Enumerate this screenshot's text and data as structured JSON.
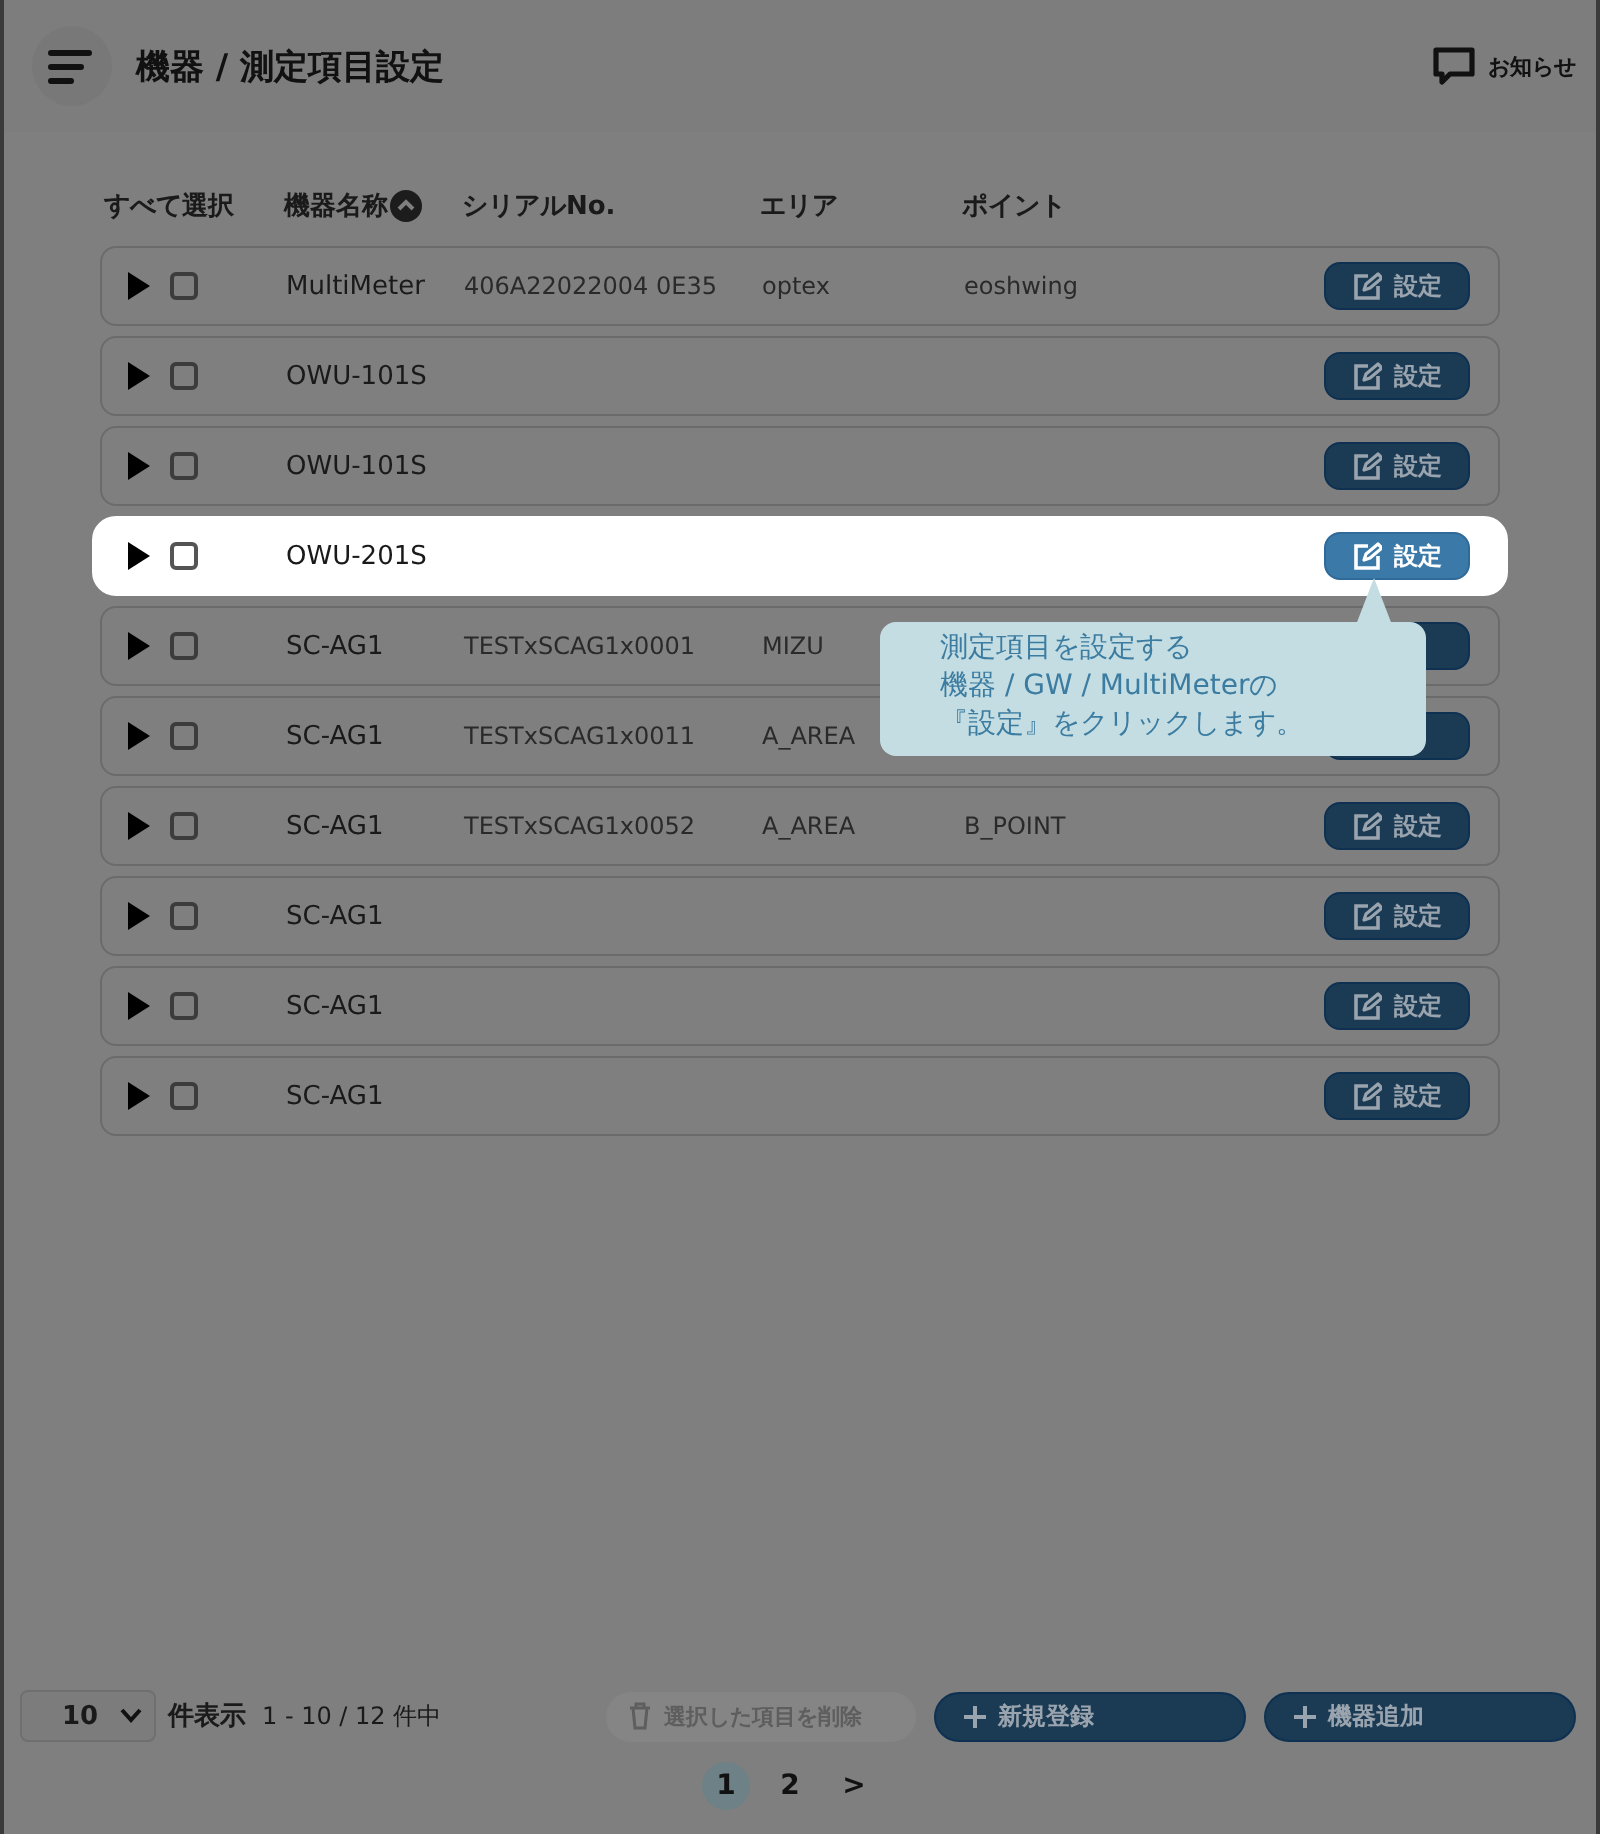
{
  "header": {
    "title": "機器 / 測定項目設定",
    "notice_label": "お知らせ"
  },
  "table": {
    "select_all_label": "すべて選択",
    "columns": [
      "機器名称",
      "シリアルNo.",
      "エリア",
      "ポイント"
    ],
    "rows": [
      {
        "name": "MultiMeter",
        "serial": "406A22022004 0E35",
        "area": "optex",
        "point": "eoshwing",
        "checked": false,
        "highlighted": false,
        "button": "設定"
      },
      {
        "name": "OWU-101S",
        "checked": false,
        "highlighted": false,
        "button": "設定"
      },
      {
        "name": "OWU-101S",
        "checked": false,
        "highlighted": false,
        "button": "設定"
      },
      {
        "name": "OWU-201S",
        "checked": false,
        "highlighted": true,
        "button": "設定"
      },
      {
        "name": "SC-AG1",
        "serial": "TESTxSCAG1x0001",
        "area": "MIZU",
        "checked": false,
        "highlighted": false
      },
      {
        "name": "SC-AG1",
        "serial": "TESTxSCAG1x0011",
        "area": "A_AREA",
        "checked": false,
        "highlighted": false
      },
      {
        "name": "SC-AG1",
        "serial": "TESTxSCAG1x0052",
        "area": "A_AREA",
        "point": "B_POINT",
        "checked": false,
        "highlighted": false,
        "button": "設定"
      },
      {
        "name": "SC-AG1",
        "checked": false,
        "highlighted": false,
        "button": "設定"
      },
      {
        "name": "SC-AG1",
        "checked": false,
        "highlighted": false,
        "button": "設定"
      },
      {
        "name": "SC-AG1",
        "checked": false,
        "highlighted": false,
        "button": "設定"
      }
    ]
  },
  "tooltip": {
    "lines": [
      "測定項目を設定する",
      "機器 / GW / MultiMeterの",
      "『設定』をクリックします。"
    ]
  },
  "footer": {
    "page_size": "10",
    "page_size_label": "件表示",
    "range": "1 - 10 / 12 件中",
    "actions": [
      {
        "label": "選択した項目を削除",
        "kind": "delete",
        "disabled": true
      },
      {
        "label": "新規登録",
        "kind": "add",
        "disabled": false
      },
      {
        "label": "機器追加",
        "kind": "add",
        "disabled": false
      }
    ],
    "pages": [
      {
        "label": "1",
        "selected": true
      },
      {
        "label": "2",
        "selected": false
      },
      {
        "label": ">",
        "selected": false
      }
    ]
  }
}
